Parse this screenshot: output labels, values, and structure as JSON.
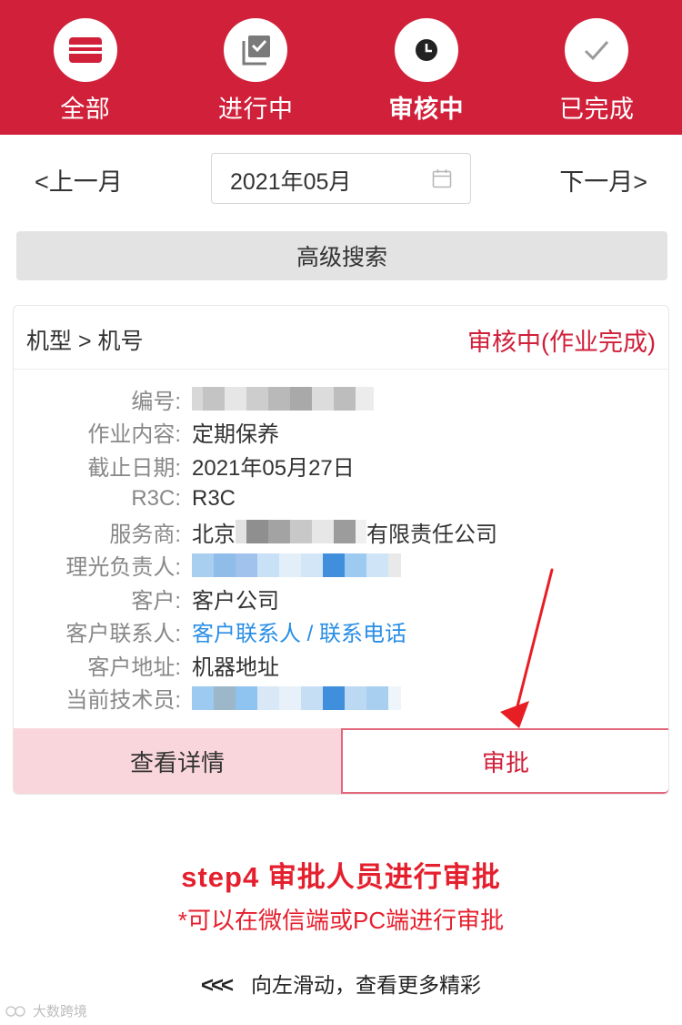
{
  "tabs": [
    {
      "label": "全部",
      "icon": "card-icon",
      "active": false
    },
    {
      "label": "进行中",
      "icon": "checklist-icon",
      "active": false
    },
    {
      "label": "审核中",
      "icon": "clock-icon",
      "active": true
    },
    {
      "label": "已完成",
      "icon": "check-icon",
      "active": false
    }
  ],
  "month_nav": {
    "prev_label": "<上一月",
    "next_label": "下一月>",
    "current": "2021年05月"
  },
  "search": {
    "label": "高级搜索"
  },
  "card": {
    "title": "机型 > 机号",
    "status": "审核中(作业完成)",
    "fields": [
      {
        "label": "编号:",
        "value": ""
      },
      {
        "label": "作业内容:",
        "value": "定期保养"
      },
      {
        "label": "截止日期:",
        "value": "2021年05月27日"
      },
      {
        "label": "R3C:",
        "value": "R3C"
      },
      {
        "label": "服务商:",
        "value_prefix": "北京",
        "value_suffix": "有限责任公司"
      },
      {
        "label": "理光负责人:",
        "value": ""
      },
      {
        "label": "客户:",
        "value": "客户公司"
      },
      {
        "label": "客户联系人:",
        "value": "客户联系人 / 联系电话"
      },
      {
        "label": "客户地址:",
        "value": "机器地址"
      },
      {
        "label": "当前技术员:",
        "value": ""
      }
    ],
    "detail_button": "查看详情",
    "approve_button": "审批"
  },
  "caption": {
    "title": "step4   审批人员进行审批",
    "subtitle": "*可以在微信端或PC端进行审批",
    "swipe": "向左滑动，查看更多精彩",
    "swipe_glyph": "<<<"
  },
  "watermark": "大数跨境",
  "colors": {
    "brand_red": "#d0203a",
    "link_blue": "#2a8ee6",
    "caption_red": "#e5202e"
  }
}
